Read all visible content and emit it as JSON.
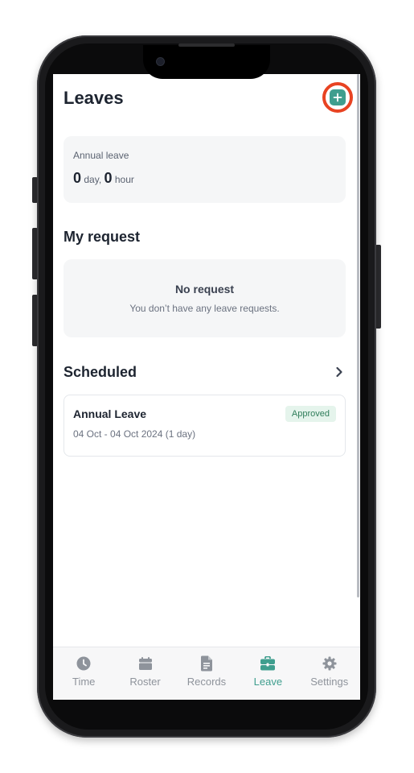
{
  "header": {
    "title": "Leaves",
    "add_icon": "plus-icon",
    "accent_color": "#3f9e8e",
    "highlight_color": "#e84322"
  },
  "balance": {
    "label": "Annual leave",
    "days": "0",
    "day_unit": "day,",
    "hours": "0",
    "hour_unit": "hour"
  },
  "my_request": {
    "title": "My request",
    "empty_title": "No request",
    "empty_subtitle": "You don’t have any leave requests."
  },
  "scheduled": {
    "title": "Scheduled",
    "items": [
      {
        "type": "Annual Leave",
        "dates": "04 Oct - 04 Oct 2024 (1 day)",
        "status": "Approved"
      }
    ]
  },
  "tabs": [
    {
      "label": "Time",
      "icon": "clock-icon",
      "active": false
    },
    {
      "label": "Roster",
      "icon": "calendar-icon",
      "active": false
    },
    {
      "label": "Records",
      "icon": "document-icon",
      "active": false
    },
    {
      "label": "Leave",
      "icon": "briefcase-icon",
      "active": true
    },
    {
      "label": "Settings",
      "icon": "gear-icon",
      "active": false
    }
  ]
}
